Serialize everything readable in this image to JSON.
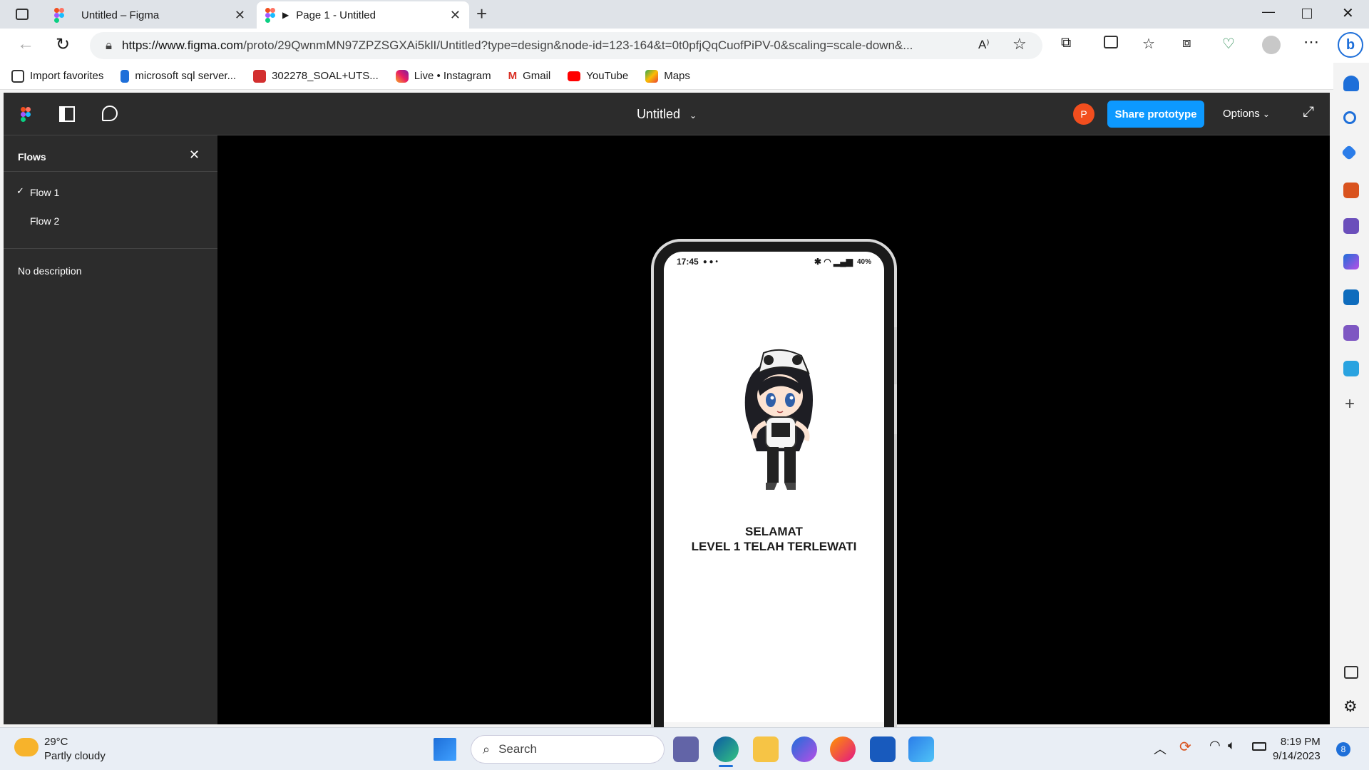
{
  "browser": {
    "tabs": [
      {
        "title": "Untitled – Figma",
        "active": false
      },
      {
        "title": "Page 1 - Untitled",
        "active": true
      }
    ],
    "url": {
      "domain": "https://www.figma.com",
      "path": "/proto/29QwnmMN97ZPZSGXAi5klI/Untitled?type=design&node-id=123-164&t=0t0pfjQqCuofPiPV-0&scaling=scale-down&..."
    },
    "bookmarks": [
      "Import favorites",
      "microsoft sql server...",
      "302278_SOAL+UTS...",
      "Live • Instagram",
      "Gmail",
      "YouTube",
      "Maps"
    ]
  },
  "figma": {
    "title": "Untitled",
    "avatar_letter": "P",
    "share_label": "Share prototype",
    "options_label": "Options",
    "panel": {
      "heading": "Flows",
      "flows": [
        {
          "label": "Flow 1",
          "selected": true
        },
        {
          "label": "Flow 2",
          "selected": false
        }
      ],
      "description": "No description"
    }
  },
  "phone": {
    "time": "17:45",
    "battery": "40%",
    "message_line1": "SELAMAT",
    "message_line2": "LEVEL 1 TELAH TERLEWATI"
  },
  "taskbar": {
    "temperature": "29°C",
    "weather": "Partly cloudy",
    "search_placeholder": "Search",
    "time": "8:19 PM",
    "date": "9/14/2023",
    "notification_count": "8"
  },
  "colors": {
    "accent": "#0d99ff",
    "figma_dark": "#2c2c2c",
    "avatar": "#f24e1e"
  }
}
